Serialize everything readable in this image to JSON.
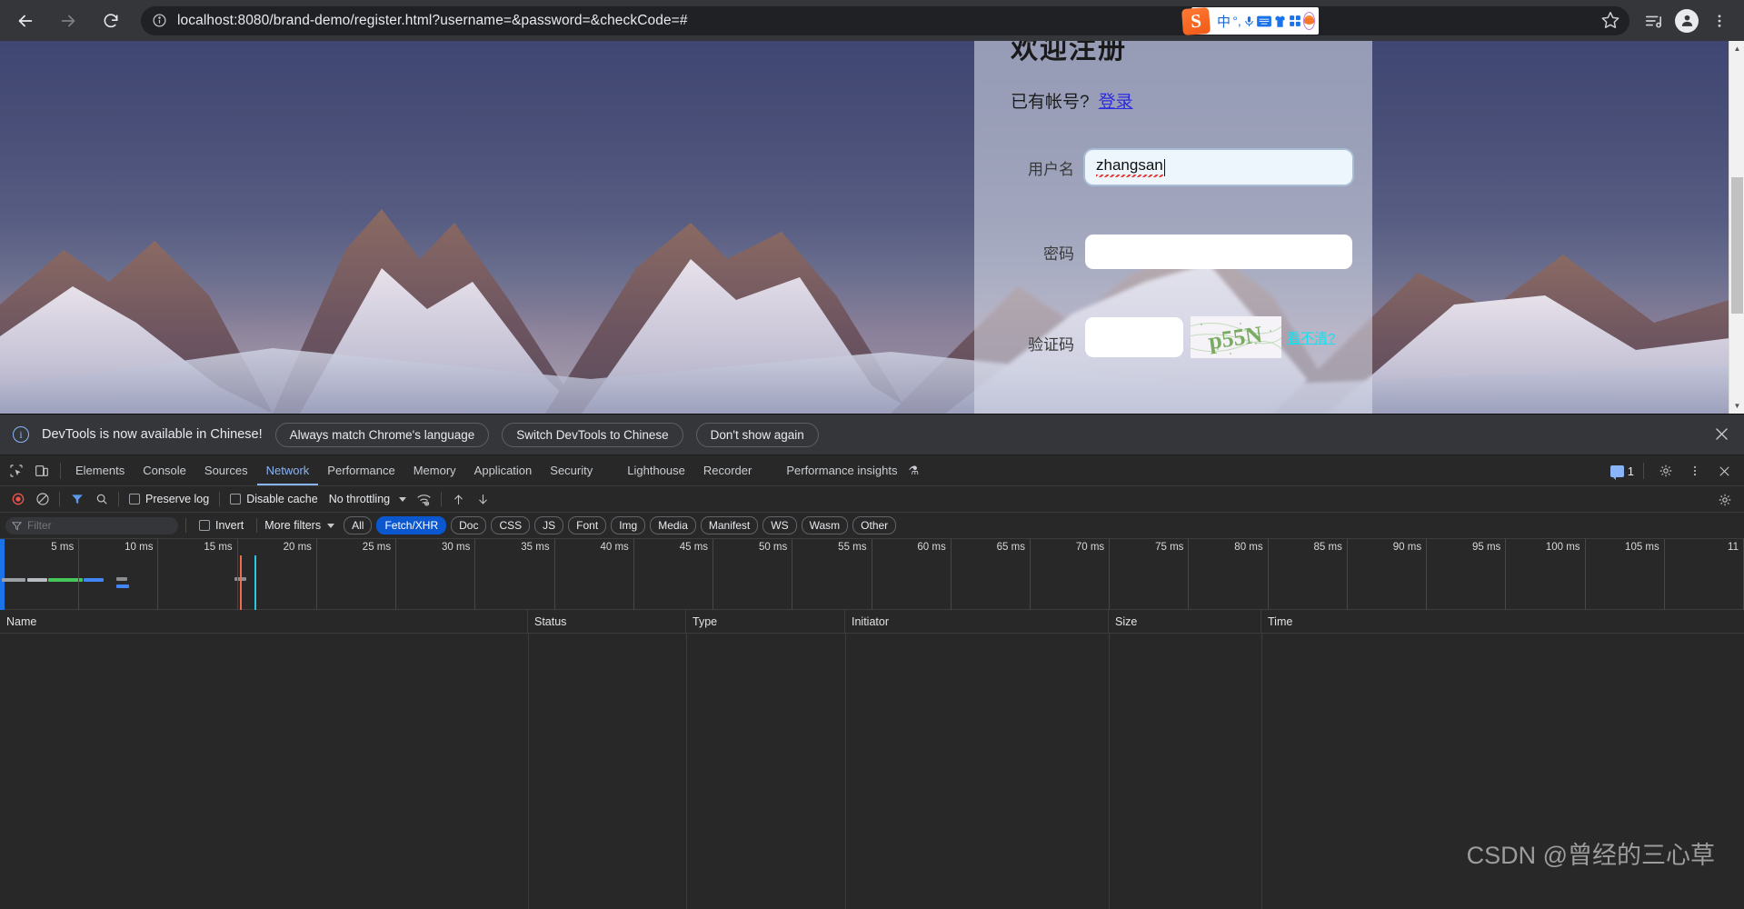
{
  "browser": {
    "back_label": "Back",
    "forward_label": "Forward",
    "reload_label": "Reload",
    "site_info_label": "View site information",
    "url": "localhost:8080/brand-demo/register.html?username=&password=&checkCode=#",
    "bookmark_label": "Bookmark this tab",
    "reading_list_label": "Reading list",
    "profile_label": "Profile",
    "menu_label": "Customize and control Google Chrome"
  },
  "ime": {
    "logo": "S",
    "chinese_mode": "中",
    "punctuation": "°,",
    "voice": "voice-input-icon",
    "keyboard": "keyboard-icon",
    "skin": "skin-icon",
    "apps": "apps-icon",
    "mascot": "mascot-icon"
  },
  "page": {
    "title": "欢迎注册",
    "have_account_text": "已有帐号?",
    "login_link": "登录",
    "fields": [
      {
        "label": "用户名",
        "value": "zhangsan",
        "placeholder": ""
      },
      {
        "label": "密码",
        "value": "",
        "placeholder": ""
      },
      {
        "label": "验证码",
        "value": "",
        "placeholder": ""
      }
    ],
    "captcha_alt": "captcha-image",
    "captcha_text": "p55N",
    "captcha_refresh": "看不清?",
    "scrollbar_up": "▲",
    "scrollbar_down": "▼"
  },
  "devtools": {
    "infobar": {
      "icon": "info-icon",
      "message": "DevTools is now available in Chinese!",
      "buttons": [
        "Always match Chrome's language",
        "Switch DevTools to Chinese",
        "Don't show again"
      ],
      "close": "×"
    },
    "tools": {
      "inspect": "inspect-element-icon",
      "device": "device-toolbar-icon"
    },
    "tabs": [
      {
        "label": "Elements",
        "active": false
      },
      {
        "label": "Console",
        "active": false
      },
      {
        "label": "Sources",
        "active": false
      },
      {
        "label": "Network",
        "active": true
      },
      {
        "label": "Performance",
        "active": false
      },
      {
        "label": "Memory",
        "active": false
      },
      {
        "label": "Application",
        "active": false
      },
      {
        "label": "Security",
        "active": false
      },
      {
        "label": "Lighthouse",
        "active": false
      },
      {
        "label": "Recorder",
        "active": false
      },
      {
        "label": "Performance insights",
        "active": false
      }
    ],
    "tabbar_right": {
      "message_count": "1",
      "settings": "gear-icon",
      "more": "kebab-menu-icon",
      "close": "close-icon"
    },
    "network_toolbar": {
      "record": "record-stop-icon",
      "clear": "clear-icon",
      "filter": "filter-icon",
      "search": "search-icon",
      "preserve_log": "Preserve log",
      "disable_cache": "Disable cache",
      "throttling": "No throttling",
      "network_conditions": "network-conditions-icon",
      "import_har": "import-har-icon",
      "export_har": "export-har-icon",
      "settings": "settings-icon"
    },
    "filter_bar": {
      "filter_placeholder": "Filter",
      "invert": "Invert",
      "more_filters": "More filters",
      "types": [
        {
          "label": "All",
          "selected": false
        },
        {
          "label": "Fetch/XHR",
          "selected": true
        },
        {
          "label": "Doc",
          "selected": false
        },
        {
          "label": "CSS",
          "selected": false
        },
        {
          "label": "JS",
          "selected": false
        },
        {
          "label": "Font",
          "selected": false
        },
        {
          "label": "Img",
          "selected": false
        },
        {
          "label": "Media",
          "selected": false
        },
        {
          "label": "Manifest",
          "selected": false
        },
        {
          "label": "WS",
          "selected": false
        },
        {
          "label": "Wasm",
          "selected": false
        },
        {
          "label": "Other",
          "selected": false
        }
      ]
    },
    "timeline": {
      "ticks": [
        "5 ms",
        "10 ms",
        "15 ms",
        "20 ms",
        "25 ms",
        "30 ms",
        "35 ms",
        "40 ms",
        "45 ms",
        "50 ms",
        "55 ms",
        "60 ms",
        "65 ms",
        "70 ms",
        "75 ms",
        "80 ms",
        "85 ms",
        "90 ms",
        "95 ms",
        "100 ms",
        "105 ms",
        "11"
      ],
      "colors": {
        "dns": "#9aa0a6",
        "connect": "#f0a45a",
        "response": "#4caf50",
        "wait": "#4285f4",
        "dcl": "#f06c4a",
        "load": "#2cc6e0"
      }
    },
    "grid_columns": [
      "Name",
      "Status",
      "Type",
      "Initiator",
      "Size",
      "Time"
    ]
  },
  "watermark": "CSDN @曾经的三心草"
}
